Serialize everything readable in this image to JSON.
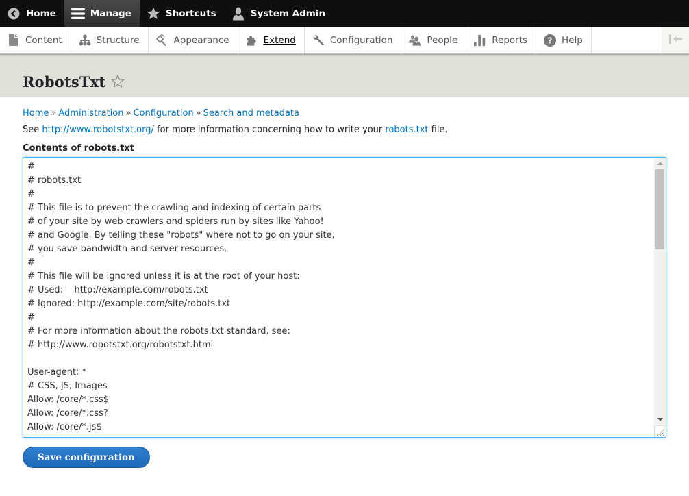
{
  "toolbar": {
    "items": [
      {
        "label": "Home",
        "icon": "back-circle-icon"
      },
      {
        "label": "Manage",
        "icon": "hamburger-icon",
        "active": true
      },
      {
        "label": "Shortcuts",
        "icon": "star-icon"
      },
      {
        "label": "System Admin",
        "icon": "user-icon"
      }
    ]
  },
  "tray": {
    "items": [
      {
        "label": "Content",
        "icon": "file-icon"
      },
      {
        "label": "Structure",
        "icon": "sitemap-icon"
      },
      {
        "label": "Appearance",
        "icon": "paint-icon"
      },
      {
        "label": "Extend",
        "icon": "puzzle-icon",
        "current": true
      },
      {
        "label": "Configuration",
        "icon": "wrench-icon"
      },
      {
        "label": "People",
        "icon": "people-icon"
      },
      {
        "label": "Reports",
        "icon": "bar-chart-icon"
      },
      {
        "label": "Help",
        "icon": "help-icon"
      }
    ],
    "toggle_icon": "collapse-arrow-icon"
  },
  "page": {
    "title": "RobotsTxt",
    "breadcrumb": [
      "Home",
      "Administration",
      "Configuration",
      "Search and metadata"
    ],
    "breadcrumb_sep": "»",
    "help": {
      "prefix": "See ",
      "link1": "http://www.robotstxt.org/",
      "middle": " for more information concerning how to write your ",
      "link2": "robots.txt",
      "suffix": " file."
    },
    "field_label": "Contents of robots.txt",
    "textarea_lines": [
      "#",
      "# robots.txt",
      "#",
      "# This file is to prevent the crawling and indexing of certain parts",
      "# of your site by web crawlers and spiders run by sites like Yahoo!",
      "# and Google. By telling these \"robots\" where not to go on your site,",
      "# you save bandwidth and server resources.",
      "#",
      "# This file will be ignored unless it is at the root of your host:",
      "# Used:    http://example.com/robots.txt",
      "# Ignored: http://example.com/site/robots.txt",
      "#",
      "# For more information about the robots.txt standard, see:",
      "# http://www.robotstxt.org/robotstxt.html",
      "",
      "User-agent: *",
      "# CSS, JS, Images",
      "Allow: /core/*.css$",
      "Allow: /core/*.css?",
      "Allow: /core/*.js$"
    ],
    "save_label": "Save configuration"
  },
  "colors": {
    "link": "#0074bd",
    "toolbar_bg": "#0f0f0f",
    "header_bg": "#e0e0d8",
    "button": "#2369bd",
    "focus_border": "#40b6ff"
  }
}
